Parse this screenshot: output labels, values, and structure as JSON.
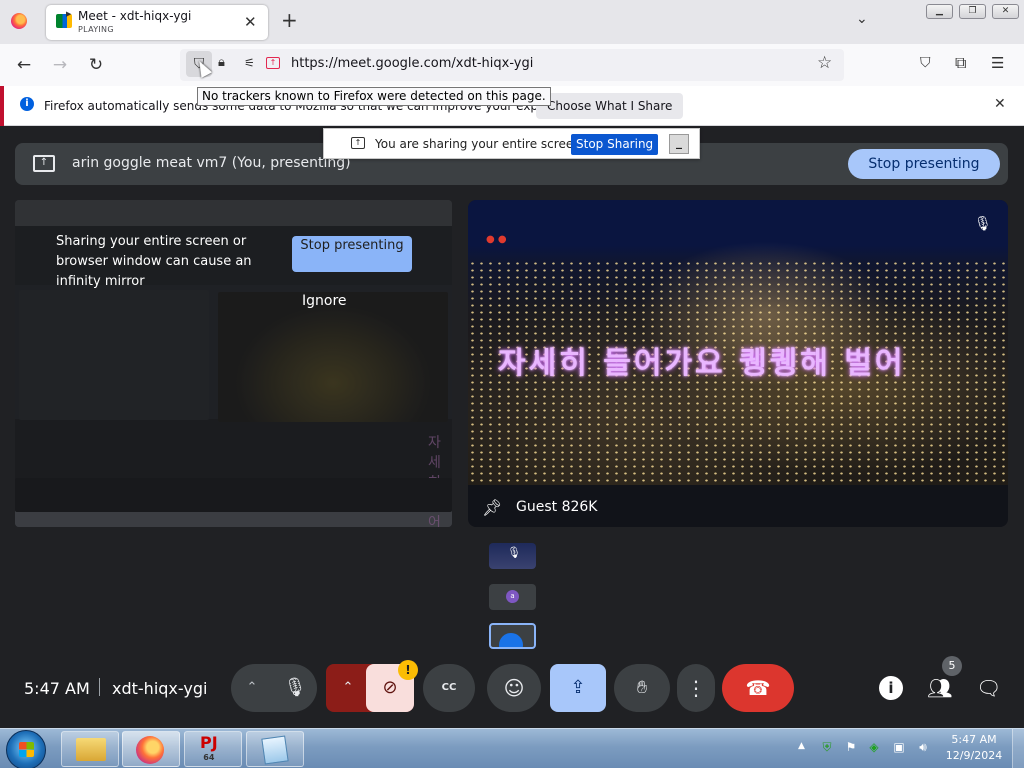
{
  "browser": {
    "tab": {
      "title": "Meet - xdt-hiqx-ygi",
      "status": "PLAYING"
    },
    "url": "https://meet.google.com/xdt-hiqx-ygi",
    "tooltip": "No trackers known to Firefox were detected on this page.",
    "notification": {
      "text": "Firefox automatically sends some data to Mozilla so that we can improve your experience.",
      "button": "Choose What I Share"
    },
    "icons": [
      "firefox-logo",
      "close-icon",
      "plus-icon",
      "chevron-down-icon",
      "back-arrow-icon",
      "forward-arrow-icon",
      "reload-icon",
      "shield-icon",
      "lock-icon",
      "permissions-icon",
      "screen-share-icon",
      "star-icon",
      "pocket-icon",
      "extensions-icon",
      "hamburger-menu-icon"
    ]
  },
  "sharing_bar": {
    "text": "You are sharing your entire screen.",
    "stop_button": "Stop Sharing",
    "minimize": "_"
  },
  "meet": {
    "presenting_banner": {
      "title": "arin goggle meat vm7 (You, presenting)",
      "stop_button": "Stop presenting"
    },
    "infinity_mirror": {
      "message": "Sharing your entire screen or browser window can cause an infinity mirror",
      "stop_button": "Stop presenting",
      "ignore_button": "Ignore"
    },
    "guest_tile": {
      "name": "Guest 826K",
      "subtitle": "자세히 들어가요 퀭퀭해 벌어"
    },
    "thumbnails": [
      {
        "label": "muted participant"
      },
      {
        "avatar_letter": "a"
      },
      {
        "label": "self"
      }
    ],
    "controls": {
      "time": "5:47 AM",
      "meeting_code": "xdt-hiqx-ygi",
      "captions_label": "CC",
      "camera_warning": "!",
      "participant_count": "5"
    }
  },
  "taskbar": {
    "apps": [
      {
        "name": "Windows Explorer"
      },
      {
        "name": "Firefox"
      },
      {
        "name": "Project64",
        "label": "PJ",
        "sub": "64"
      },
      {
        "name": "Notepad"
      }
    ],
    "clock": {
      "time": "5:47 AM",
      "date": "12/9/2024"
    }
  },
  "colors": {
    "meet_bg": "#202124",
    "meet_surface": "#3c4043",
    "accent_blue": "#a8c7fa",
    "end_call_red": "#dc362e",
    "camera_off_red": "#8c1d18",
    "firefox_blue": "#0060df"
  }
}
